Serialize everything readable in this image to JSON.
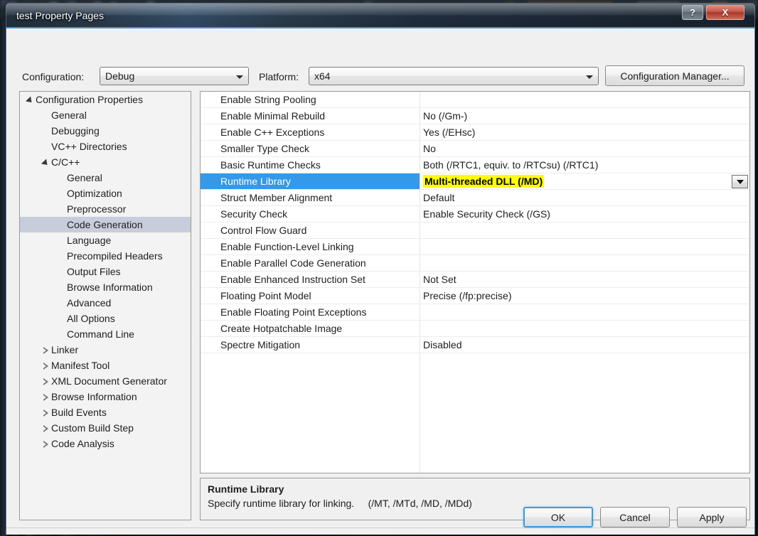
{
  "window": {
    "title": "test Property Pages",
    "help_button": "?",
    "close_button": "X"
  },
  "toolbar": {
    "configuration_label": "Configuration:",
    "configuration_value": "Debug",
    "platform_label": "Platform:",
    "platform_value": "x64",
    "configuration_manager_button": "Configuration Manager..."
  },
  "tree": {
    "items": [
      {
        "label": "Configuration Properties",
        "indent": 0,
        "state": "expanded",
        "selected": false
      },
      {
        "label": "General",
        "indent": 1,
        "state": "leaf",
        "selected": false
      },
      {
        "label": "Debugging",
        "indent": 1,
        "state": "leaf",
        "selected": false
      },
      {
        "label": "VC++ Directories",
        "indent": 1,
        "state": "leaf",
        "selected": false
      },
      {
        "label": "C/C++",
        "indent": 1,
        "state": "expanded",
        "selected": false
      },
      {
        "label": "General",
        "indent": 2,
        "state": "leaf",
        "selected": false
      },
      {
        "label": "Optimization",
        "indent": 2,
        "state": "leaf",
        "selected": false
      },
      {
        "label": "Preprocessor",
        "indent": 2,
        "state": "leaf",
        "selected": false
      },
      {
        "label": "Code Generation",
        "indent": 2,
        "state": "leaf",
        "selected": true
      },
      {
        "label": "Language",
        "indent": 2,
        "state": "leaf",
        "selected": false
      },
      {
        "label": "Precompiled Headers",
        "indent": 2,
        "state": "leaf",
        "selected": false
      },
      {
        "label": "Output Files",
        "indent": 2,
        "state": "leaf",
        "selected": false
      },
      {
        "label": "Browse Information",
        "indent": 2,
        "state": "leaf",
        "selected": false
      },
      {
        "label": "Advanced",
        "indent": 2,
        "state": "leaf",
        "selected": false
      },
      {
        "label": "All Options",
        "indent": 2,
        "state": "leaf",
        "selected": false
      },
      {
        "label": "Command Line",
        "indent": 2,
        "state": "leaf",
        "selected": false
      },
      {
        "label": "Linker",
        "indent": 1,
        "state": "collapsed",
        "selected": false
      },
      {
        "label": "Manifest Tool",
        "indent": 1,
        "state": "collapsed",
        "selected": false
      },
      {
        "label": "XML Document Generator",
        "indent": 1,
        "state": "collapsed",
        "selected": false
      },
      {
        "label": "Browse Information",
        "indent": 1,
        "state": "collapsed",
        "selected": false
      },
      {
        "label": "Build Events",
        "indent": 1,
        "state": "collapsed",
        "selected": false
      },
      {
        "label": "Custom Build Step",
        "indent": 1,
        "state": "collapsed",
        "selected": false
      },
      {
        "label": "Code Analysis",
        "indent": 1,
        "state": "collapsed",
        "selected": false
      }
    ]
  },
  "grid": {
    "rows": [
      {
        "name": "Enable String Pooling",
        "value": "",
        "selected": false,
        "highlight": false
      },
      {
        "name": "Enable Minimal Rebuild",
        "value": "No (/Gm-)",
        "selected": false,
        "highlight": false
      },
      {
        "name": "Enable C++ Exceptions",
        "value": "Yes (/EHsc)",
        "selected": false,
        "highlight": false
      },
      {
        "name": "Smaller Type Check",
        "value": "No",
        "selected": false,
        "highlight": false
      },
      {
        "name": "Basic Runtime Checks",
        "value": "Both (/RTC1, equiv. to /RTCsu) (/RTC1)",
        "selected": false,
        "highlight": false
      },
      {
        "name": "Runtime Library",
        "value": "Multi-threaded DLL (/MD)",
        "selected": true,
        "highlight": true
      },
      {
        "name": "Struct Member Alignment",
        "value": "Default",
        "selected": false,
        "highlight": false
      },
      {
        "name": "Security Check",
        "value": "Enable Security Check (/GS)",
        "selected": false,
        "highlight": false
      },
      {
        "name": "Control Flow Guard",
        "value": "",
        "selected": false,
        "highlight": false
      },
      {
        "name": "Enable Function-Level Linking",
        "value": "",
        "selected": false,
        "highlight": false
      },
      {
        "name": "Enable Parallel Code Generation",
        "value": "",
        "selected": false,
        "highlight": false
      },
      {
        "name": "Enable Enhanced Instruction Set",
        "value": "Not Set",
        "selected": false,
        "highlight": false
      },
      {
        "name": "Floating Point Model",
        "value": "Precise (/fp:precise)",
        "selected": false,
        "highlight": false
      },
      {
        "name": "Enable Floating Point Exceptions",
        "value": "",
        "selected": false,
        "highlight": false
      },
      {
        "name": "Create Hotpatchable Image",
        "value": "",
        "selected": false,
        "highlight": false
      },
      {
        "name": "Spectre Mitigation",
        "value": "Disabled",
        "selected": false,
        "highlight": false
      }
    ]
  },
  "description": {
    "title": "Runtime Library",
    "text": "Specify runtime library for linking.     (/MT, /MTd, /MD, /MDd)"
  },
  "buttons": {
    "ok": "OK",
    "cancel": "Cancel",
    "apply": "Apply"
  },
  "colors": {
    "grid_selection_blue": "#3399e8",
    "value_highlight_yellow": "#ffff00",
    "tree_selection": "#c8cddc",
    "dialog_accent": "#3d93d0"
  }
}
